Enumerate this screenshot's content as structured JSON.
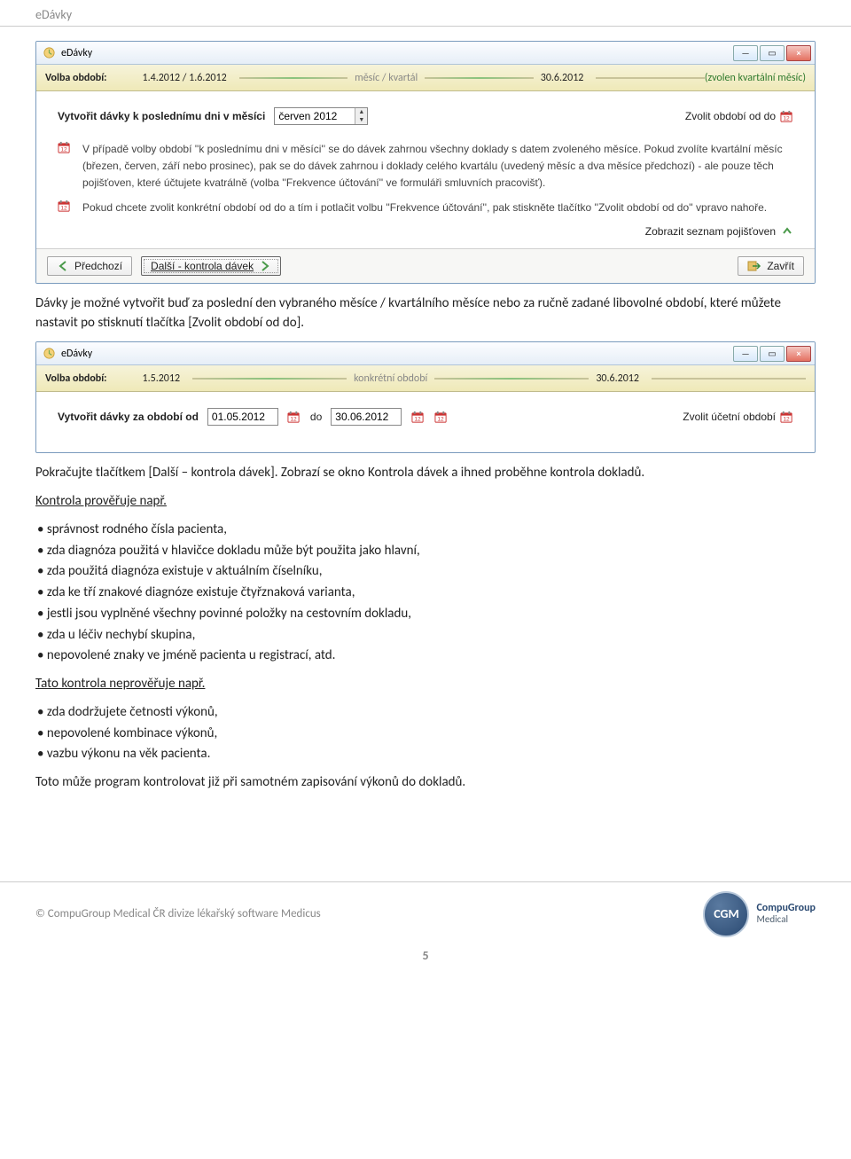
{
  "header": {
    "title": "eDávky"
  },
  "window1": {
    "title": "eDávky",
    "optbar": {
      "label": "Volba období:",
      "period_from": "1.4.2012 / 1.6.2012",
      "period_type": "měsíc / kvartál",
      "period_to": "30.6.2012",
      "right_note": "(zvolen kvartální měsíc)"
    },
    "body": {
      "create_label": "Vytvořit dávky k poslednímu dni v měsíci",
      "month_value": "červen 2012",
      "right_link": "Zvolit období od do",
      "info1": "V případě volby období ''k poslednímu dni v měsíci'' se do dávek zahrnou všechny doklady s datem zvoleného měsíce. Pokud zvolíte kvartální měsíc (březen, červen, září nebo prosinec), pak se do dávek zahrnou i doklady celého kvartálu (uvedený měsíc a dva měsíce předchozí) - ale pouze těch pojišťoven, které účtujete kvatrálně (volba ''Frekvence účtování'' ve formuláři smluvních pracovišť).",
      "info2": "Pokud chcete zvolit konkrétní období od do a tím i potlačit volbu ''Frekvence účtování'', pak stiskněte tlačítko ''Zvolit období od do'' vpravo nahoře.",
      "list_link": "Zobrazit seznam pojišťoven"
    },
    "buttons": {
      "prev": "Předchozí",
      "next": "Další - kontrola dávek",
      "close": "Zavřít"
    }
  },
  "para1": "Dávky je možné vytvořit buď za poslední den vybraného měsíce / kvartálního měsíce nebo za ručně zadané libovolné období, které můžete nastavit po stisknutí tlačítka [Zvolit období od do].",
  "window2": {
    "title": "eDávky",
    "optbar": {
      "label": "Volba období:",
      "period_from": "1.5.2012",
      "period_type": "konkrétní období",
      "period_to": "30.6.2012"
    },
    "body": {
      "create_label": "Vytvořit dávky za období od",
      "date_from": "01.05.2012",
      "date_to_label": "do",
      "date_to": "30.06.2012",
      "right_link": "Zvolit účetní období"
    }
  },
  "para2": "Pokračujte tlačítkem [Další – kontrola dávek]. Zobrazí se okno Kontrola dávek a ihned proběhne kontrola dokladů.",
  "list1_heading": "Kontrola prověřuje např.",
  "list1": [
    "správnost rodného čísla pacienta,",
    "zda diagnóza použitá v hlavičce dokladu může být použita jako hlavní,",
    "zda použitá diagnóza existuje v aktuálním číselníku,",
    "zda ke tří znakové diagnóze existuje čtyřznaková varianta,",
    "jestli jsou vyplněné všechny povinné položky na cestovním dokladu,",
    "zda u léčiv nechybí skupina,",
    "nepovolené znaky ve jméně pacienta u registrací, atd."
  ],
  "list2_heading": "Tato kontrola neprověřuje např.",
  "list2": [
    "zda dodržujete četnosti výkonů,",
    "nepovolené kombinace výkonů,",
    "vazbu výkonu na věk pacienta."
  ],
  "para3": "Toto může program kontrolovat již při samotném zapisování výkonů do dokladů.",
  "footer": {
    "copyright": "© CompuGroup Medical ČR divize lékařský software Medicus",
    "logo_abbr": "CGM",
    "logo_line1": "CompuGroup",
    "logo_line2": "Medical",
    "page_number": "5"
  }
}
